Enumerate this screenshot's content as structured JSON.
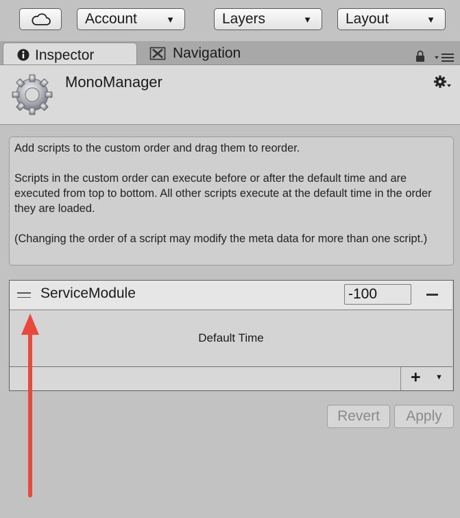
{
  "toolbar": {
    "cloud_icon": "cloud-icon",
    "account_label": "Account",
    "layers_label": "Layers",
    "layout_label": "Layout",
    "caret": "▼"
  },
  "tabs": {
    "inspector_label": "Inspector",
    "inspector_icon": "info-icon",
    "navigation_label": "Navigation",
    "navigation_icon": "navigation-icon"
  },
  "inspector": {
    "title": "MonoManager",
    "icon": "gear-icon",
    "settings_icon": "gear-icon"
  },
  "help": {
    "line1": "Add scripts to the custom order and drag them to reorder.",
    "line2": "Scripts in the custom order can execute before or after the default time and are executed from top to bottom. All other scripts execute at the default time in the order they are loaded.",
    "line3": "(Changing the order of a script may modify the meta data for more than one script.)"
  },
  "order_list": {
    "items": [
      {
        "name": "ServiceModule",
        "order": "-100",
        "remove_label": "–"
      }
    ],
    "default_time_label": "Default Time",
    "add_label": "+",
    "add_caret": "▼"
  },
  "actions": {
    "revert_label": "Revert",
    "apply_label": "Apply",
    "enabled": false
  },
  "annotation": {
    "arrow_color": "#e8493c",
    "arrow_direction": "up"
  },
  "colors": {
    "background": "#c2c2c2",
    "header": "#dadada",
    "tab_strip": "#a8a8a8"
  }
}
